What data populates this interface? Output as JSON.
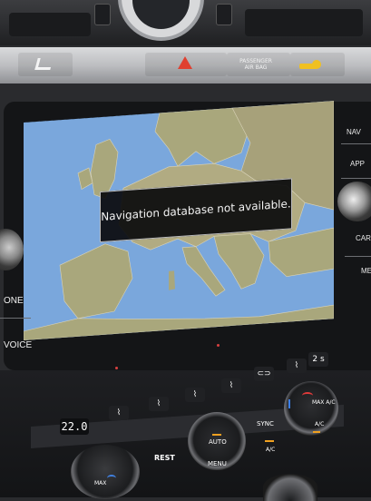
{
  "dashboard": {
    "passenger_airbag_label": "PASSENGER\nAIR BAG"
  },
  "infotainment": {
    "popup_message": "Navigation database not available.",
    "side_buttons_right": [
      "NAV",
      "APP",
      "CAR",
      "MEN"
    ],
    "side_buttons_left": [
      "ONE",
      "VOICE"
    ]
  },
  "climate": {
    "left_temp": "22.0",
    "rest_label": "REST",
    "auto_label": "AUTO",
    "menu_label": "MENU",
    "sync_label": "SYNC",
    "ac_label": "A/C",
    "max_ac_label": "MAX A/C",
    "max_label": "MAX",
    "two_s_label": "2 s"
  },
  "icons": {
    "hazard": "hazard-triangle-icon",
    "seat_heat": "seat-heat-icon",
    "car": "car-icon",
    "fan": "fan-icon"
  },
  "colors": {
    "water": "#7aa7dc",
    "land": "#a9a77c",
    "hazard": "#e04030",
    "led_amber": "#f0a020",
    "led_red": "#d94040"
  }
}
